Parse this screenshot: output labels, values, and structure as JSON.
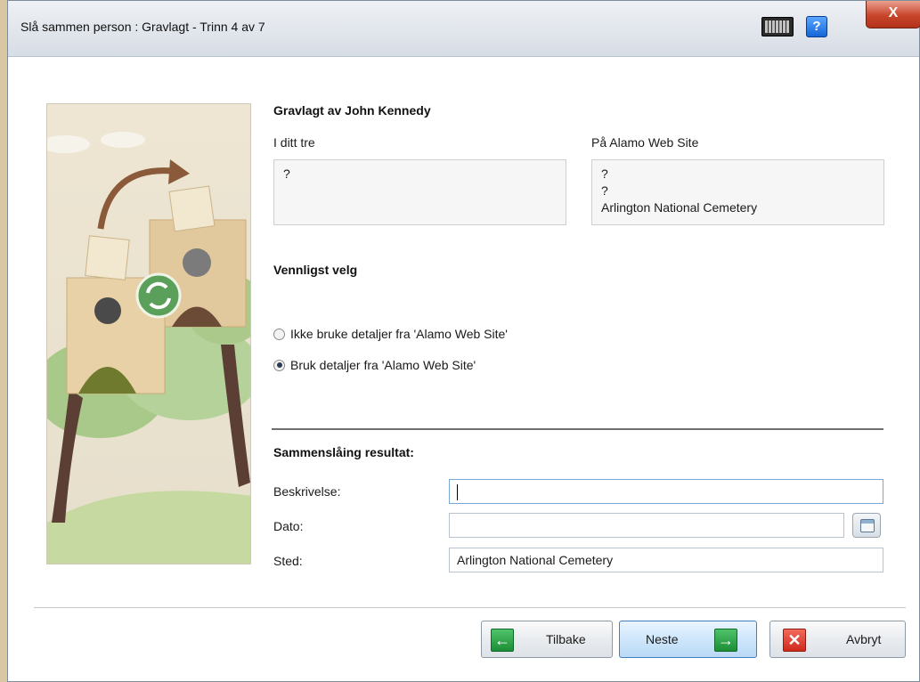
{
  "window": {
    "title": "Slå sammen person : Gravlagt - Trinn 4 av 7",
    "help_label": "?",
    "close_label": "X"
  },
  "main": {
    "heading": "Gravlagt av John Kennedy",
    "left_column": {
      "label": "I ditt tre",
      "values": [
        "?"
      ]
    },
    "right_column": {
      "label": "På Alamo Web Site",
      "values": [
        "?",
        "?",
        "Arlington National Cemetery"
      ]
    },
    "choose_heading": "Vennligst velg",
    "options": [
      {
        "label": "Ikke bruke detaljer fra 'Alamo Web Site'",
        "selected": false
      },
      {
        "label": "Bruk detaljer fra 'Alamo Web Site'",
        "selected": true
      }
    ]
  },
  "result": {
    "heading": "Sammenslåing resultat:",
    "fields": {
      "description_label": "Beskrivelse:",
      "description_value": "",
      "date_label": "Dato:",
      "date_value": "",
      "place_label": "Sted:",
      "place_value": "Arlington National Cemetery"
    }
  },
  "footer": {
    "back_label": "Tilbake",
    "next_label": "Neste",
    "cancel_label": "Avbryt"
  },
  "colors": {
    "accent_blue": "#3f7fc2",
    "green_arrow": "#1c8e36",
    "red_cancel": "#cf2a1c"
  },
  "icons": {
    "keyboard": "keyboard-icon",
    "help": "help-icon",
    "close": "close-icon",
    "calendar": "calendar-icon",
    "back": "arrow-left-icon",
    "next": "arrow-right-icon",
    "cancel": "x-icon"
  }
}
